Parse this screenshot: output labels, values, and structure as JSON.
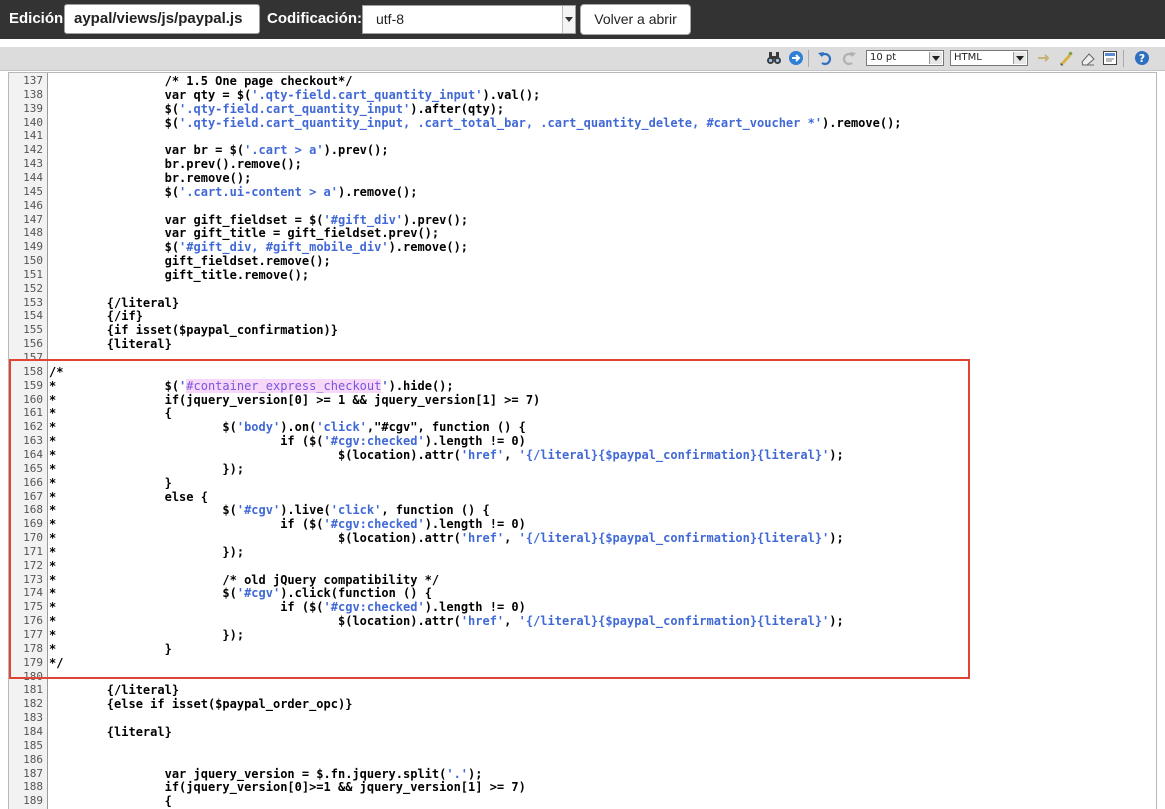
{
  "header": {
    "edit_label": "Edición:",
    "file_path": "aypal/views/js/paypal.js",
    "encoding_label": "Codificación:",
    "encoding_value": "utf-8",
    "reload_button": "Volver a abrir"
  },
  "toolbar": {
    "font_size": "10 pt",
    "syntax": "HTML",
    "icons": [
      "binoculars-icon",
      "goto-line-icon",
      "undo-icon",
      "redo-icon",
      "fullscreen-icon",
      "highlight-icon",
      "reset-icon",
      "toggle-editor-icon",
      "help-icon"
    ]
  },
  "colors": {
    "string": "#4169d6",
    "highlight_bg": "#f7d8f8",
    "highlight_text": "#7b55e0",
    "box": "#e04435"
  },
  "code_lines": [
    {
      "n": "137",
      "t": "\t\t/* 1.5 One page checkout*/"
    },
    {
      "n": "138",
      "t": "\t\tvar qty = $('.qty-field.cart_quantity_input').val();"
    },
    {
      "n": "139",
      "t": "\t\t$('.qty-field.cart_quantity_input').after(qty);"
    },
    {
      "n": "140",
      "t": "\t\t$('.qty-field.cart_quantity_input, .cart_total_bar, .cart_quantity_delete, #cart_voucher *').remove();"
    },
    {
      "n": "141",
      "t": ""
    },
    {
      "n": "142",
      "t": "\t\tvar br = $('.cart > a').prev();"
    },
    {
      "n": "143",
      "t": "\t\tbr.prev().remove();"
    },
    {
      "n": "144",
      "t": "\t\tbr.remove();"
    },
    {
      "n": "145",
      "t": "\t\t$('.cart.ui-content > a').remove();"
    },
    {
      "n": "146",
      "t": ""
    },
    {
      "n": "147",
      "t": "\t\tvar gift_fieldset = $('#gift_div').prev();"
    },
    {
      "n": "148",
      "t": "\t\tvar gift_title = gift_fieldset.prev();"
    },
    {
      "n": "149",
      "t": "\t\t$('#gift_div, #gift_mobile_div').remove();"
    },
    {
      "n": "150",
      "t": "\t\tgift_fieldset.remove();"
    },
    {
      "n": "151",
      "t": "\t\tgift_title.remove();"
    },
    {
      "n": "152",
      "t": ""
    },
    {
      "n": "153",
      "t": "\t{/literal}"
    },
    {
      "n": "154",
      "t": "\t{/if}"
    },
    {
      "n": "155",
      "t": "\t{if isset($paypal_confirmation)}"
    },
    {
      "n": "156",
      "t": "\t{literal}"
    },
    {
      "n": "157",
      "t": ""
    },
    {
      "n": "158",
      "t": "/*"
    },
    {
      "n": "159",
      "t": "*\t\t$('#container_express_checkout').hide();"
    },
    {
      "n": "160",
      "t": "*\t\tif(jquery_version[0] >= 1 && jquery_version[1] >= 7)"
    },
    {
      "n": "161",
      "t": "*\t\t{"
    },
    {
      "n": "162",
      "t": "*\t\t\t$('body').on('click',\"#cgv\", function () {"
    },
    {
      "n": "163",
      "t": "*\t\t\t\tif ($('#cgv:checked').length != 0)"
    },
    {
      "n": "164",
      "t": "*\t\t\t\t\t$(location).attr('href', '{/literal}{$paypal_confirmation}{literal}');"
    },
    {
      "n": "165",
      "t": "*\t\t\t});"
    },
    {
      "n": "166",
      "t": "*\t\t}"
    },
    {
      "n": "167",
      "t": "*\t\telse {"
    },
    {
      "n": "168",
      "t": "*\t\t\t$('#cgv').live('click', function () {"
    },
    {
      "n": "169",
      "t": "*\t\t\t\tif ($('#cgv:checked').length != 0)"
    },
    {
      "n": "170",
      "t": "*\t\t\t\t\t$(location).attr('href', '{/literal}{$paypal_confirmation}{literal}');"
    },
    {
      "n": "171",
      "t": "*\t\t\t});"
    },
    {
      "n": "172",
      "t": "*"
    },
    {
      "n": "173",
      "t": "*\t\t\t/* old jQuery compatibility */"
    },
    {
      "n": "174",
      "t": "*\t\t\t$('#cgv').click(function () {"
    },
    {
      "n": "175",
      "t": "*\t\t\t\tif ($('#cgv:checked').length != 0)"
    },
    {
      "n": "176",
      "t": "*\t\t\t\t\t$(location).attr('href', '{/literal}{$paypal_confirmation}{literal}');"
    },
    {
      "n": "177",
      "t": "*\t\t\t});"
    },
    {
      "n": "178",
      "t": "*\t\t}"
    },
    {
      "n": "179",
      "t": "*/"
    },
    {
      "n": "180",
      "t": ""
    },
    {
      "n": "181",
      "t": "\t{/literal}"
    },
    {
      "n": "182",
      "t": "\t{else if isset($paypal_order_opc)}"
    },
    {
      "n": "183",
      "t": ""
    },
    {
      "n": "184",
      "t": "\t{literal}"
    },
    {
      "n": "185",
      "t": ""
    },
    {
      "n": "186",
      "t": ""
    },
    {
      "n": "187",
      "t": "\t\tvar jquery_version = $.fn.jquery.split('.');"
    },
    {
      "n": "188",
      "t": "\t\tif(jquery_version[0]>=1 && jquery_version[1] >= 7)"
    },
    {
      "n": "189",
      "t": "\t\t{"
    }
  ]
}
